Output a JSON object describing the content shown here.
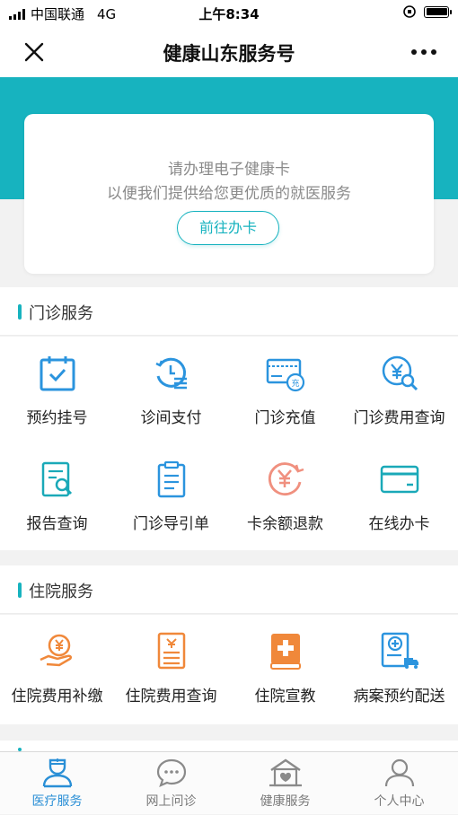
{
  "status_bar": {
    "carrier": "中国联通",
    "network": "4G",
    "time": "上午8:34"
  },
  "nav": {
    "title": "健康山东服务号"
  },
  "health_card": {
    "line1": "请办理电子健康卡",
    "line2": "以便我们提供给您更优质的就医服务",
    "button": "前往办卡"
  },
  "outpatient": {
    "title": "门诊服务",
    "items": [
      {
        "label": "预约挂号",
        "icon": "calendar-check-icon"
      },
      {
        "label": "诊间支付",
        "icon": "history-payment-icon"
      },
      {
        "label": "门诊充值",
        "icon": "card-recharge-icon"
      },
      {
        "label": "门诊费用查询",
        "icon": "yen-search-icon"
      },
      {
        "label": "报告查询",
        "icon": "report-search-icon"
      },
      {
        "label": "门诊导引单",
        "icon": "clipboard-icon"
      },
      {
        "label": "卡余额退款",
        "icon": "yen-refund-icon"
      },
      {
        "label": "在线办卡",
        "icon": "bank-card-icon"
      }
    ]
  },
  "inpatient": {
    "title": "住院服务",
    "items": [
      {
        "label": "住院费用补缴",
        "icon": "hand-yen-icon"
      },
      {
        "label": "住院费用查询",
        "icon": "bill-list-icon"
      },
      {
        "label": "住院宣教",
        "icon": "medical-book-icon"
      },
      {
        "label": "病案预约配送",
        "icon": "medical-record-delivery-icon"
      }
    ]
  },
  "tabbar": [
    {
      "label": "医疗服务",
      "icon": "doctor-icon",
      "active": true
    },
    {
      "label": "网上问诊",
      "icon": "chat-bubble-icon",
      "active": false
    },
    {
      "label": "健康服务",
      "icon": "health-house-icon",
      "active": false
    },
    {
      "label": "个人中心",
      "icon": "person-icon",
      "active": false
    }
  ],
  "colors": {
    "accent": "#17b3bf",
    "tab_active": "#2a8fd6",
    "icon_blue": "#2b94de",
    "icon_orange": "#f0883a",
    "icon_pink": "#f0907f"
  }
}
